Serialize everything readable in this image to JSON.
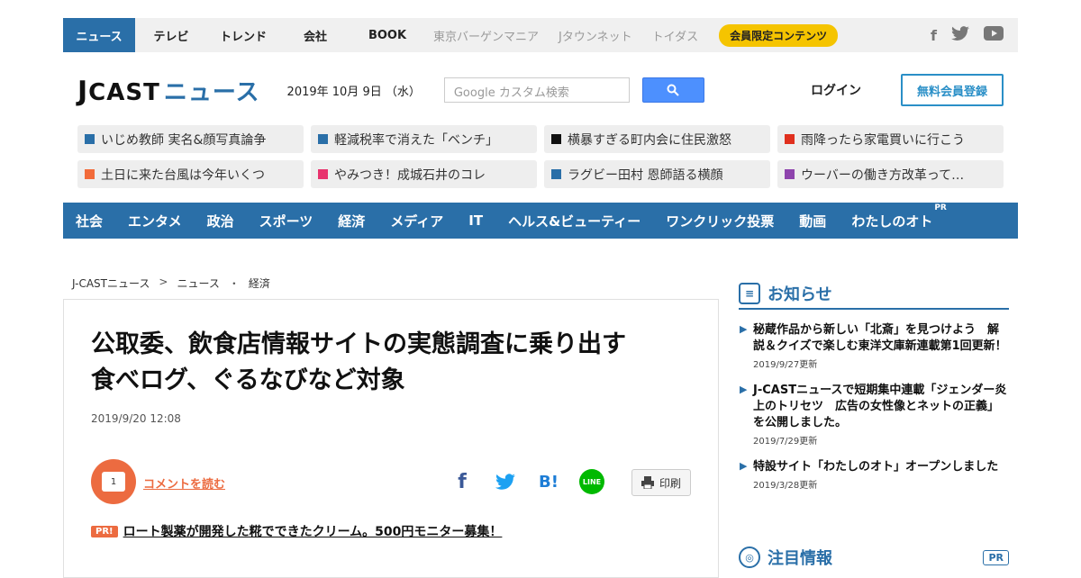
{
  "topnav": {
    "items": [
      "ニュース",
      "テレビ",
      "トレンド",
      "会社",
      "BOOK"
    ],
    "external": [
      "東京バーゲンマニア",
      "Jタウンネット",
      "トイダス"
    ],
    "member_label": "会員限定コンテンツ",
    "social_icons": [
      "facebook-icon",
      "twitter-icon",
      "youtube-icon"
    ]
  },
  "header": {
    "logo_j": "J",
    "logo_cast": "CAST",
    "logo_news": "ニュース",
    "date": "2019年 10月 9日 （水）",
    "search_placeholder": "Google カスタム検索",
    "login": "ログイン",
    "register": "無料会員登録"
  },
  "trending": [
    {
      "label": "いじめ教師 実名&顔写真論争",
      "color": "#2a6fa8"
    },
    {
      "label": "軽減税率で消えた「ベンチ」",
      "color": "#2a6fa8"
    },
    {
      "label": "横暴すぎる町内会に住民激怒",
      "color": "#111111"
    },
    {
      "label": "雨降ったら家電買いに行こう",
      "color": "#e0301e"
    },
    {
      "label": "土日に来た台風は今年いくつ",
      "color": "#f26b3a"
    },
    {
      "label": "やみつき！成城石井のコレ",
      "color": "#e8336d"
    },
    {
      "label": "ラグビー田村 恩師語る横顔",
      "color": "#2a6fa8"
    },
    {
      "label": "ウーバーの働き方改革って…",
      "color": "#8e44ad"
    }
  ],
  "catnav": [
    "社会",
    "エンタメ",
    "政治",
    "スポーツ",
    "経済",
    "メディア",
    "IT",
    "ヘルス&ビューティー",
    "ワンクリック投票",
    "動画",
    "わたしのオト"
  ],
  "catnav_pr": "PR",
  "breadcrumb": [
    "J-CASTニュース",
    "ニュース",
    "経済"
  ],
  "breadcrumb_seps": [
    ">",
    "・"
  ],
  "article": {
    "title_line1": "公取委、飲食店情報サイトの実態調査に乗り出す",
    "title_line2": "食べログ、ぐるなびなど対象",
    "date": "2019/9/20 12:08",
    "comment_count": "1",
    "comment_link": "コメントを読む",
    "share": {
      "facebook": "f",
      "twitter": "🐦",
      "hatena": "B!",
      "line": "LINE"
    },
    "print_label": "印刷",
    "pr_badge": "PR!",
    "pr_text": "ロート製薬が開発した糀でできたクリーム。500円モニター募集！"
  },
  "sidebar": {
    "notice_title": "お知らせ",
    "notices": [
      {
        "text": "秘蔵作品から新しい「北斎」を見つけよう　解説＆クイズで楽しむ東洋文庫新連載第1回更新！",
        "updated": "2019/9/27更新"
      },
      {
        "text": "J-CASTニュースで短期集中連載「ジェンダー炎上のトリセツ　広告の女性像とネットの正義」を公開しました。",
        "updated": "2019/7/29更新"
      },
      {
        "text": "特設サイト「わたしのオト」オープンしました",
        "updated": "2019/3/28更新"
      }
    ],
    "featured_title": "注目情報",
    "featured_pr": "PR"
  },
  "colors": {
    "brand_blue": "#2a6fa8",
    "accent_orange": "#ec6b40",
    "member_yellow": "#f5c400"
  }
}
